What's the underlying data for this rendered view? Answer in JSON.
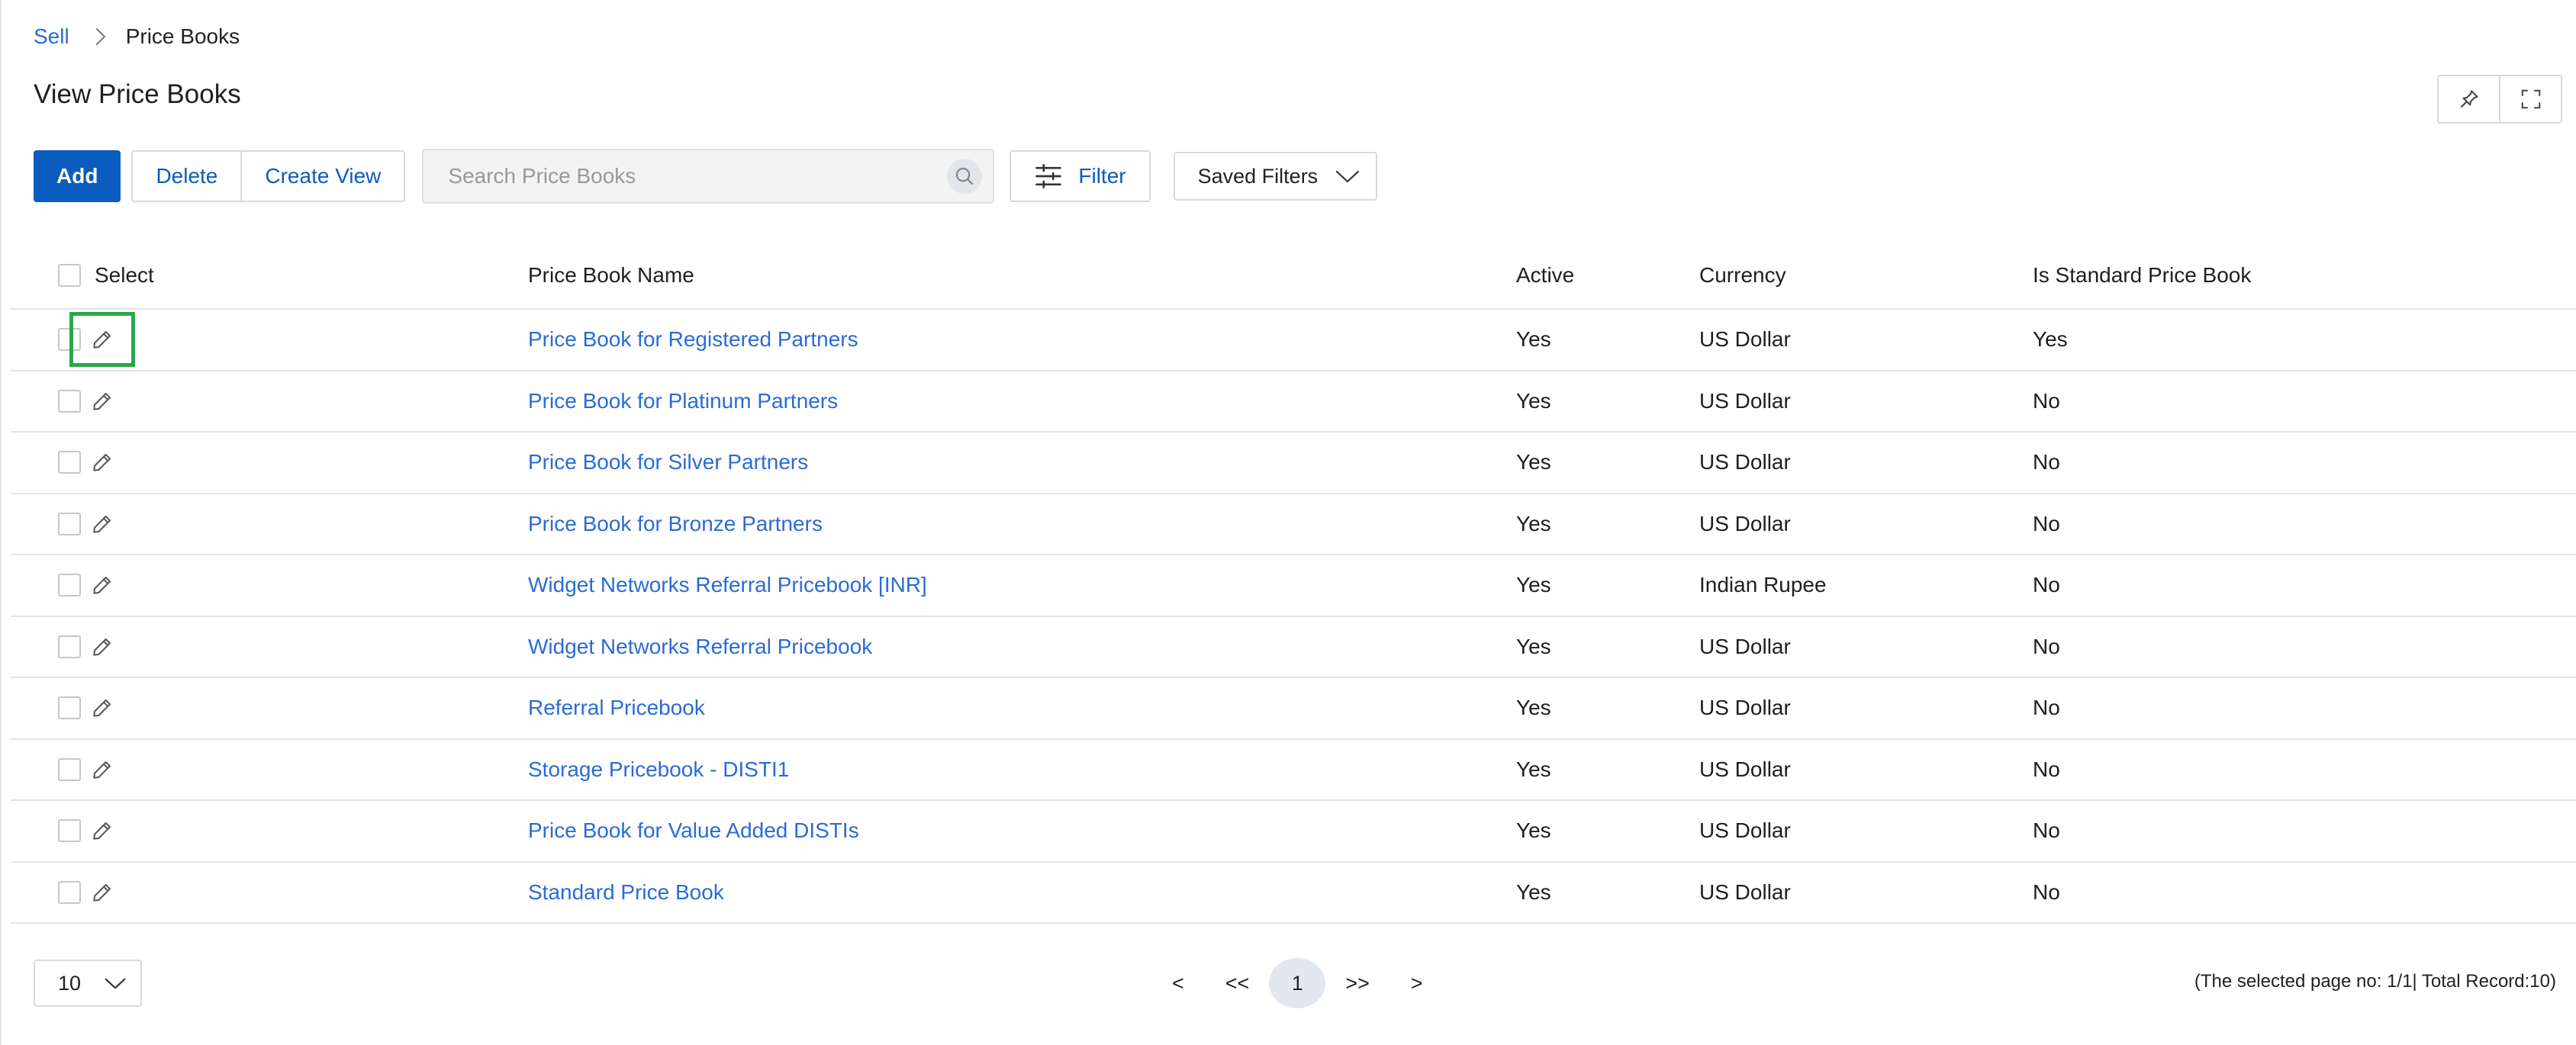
{
  "breadcrumb": {
    "root": "Sell",
    "current": "Price Books"
  },
  "page_title": "View Price Books",
  "toolbar": {
    "add_label": "Add",
    "delete_label": "Delete",
    "create_view_label": "Create View",
    "search_placeholder": "Search Price Books",
    "filter_label": "Filter",
    "saved_filters_label": "Saved Filters"
  },
  "table": {
    "headers": {
      "select": "Select",
      "name": "Price Book Name",
      "active": "Active",
      "currency": "Currency",
      "standard": "Is Standard Price Book"
    },
    "rows": [
      {
        "name": "Price Book for Registered Partners",
        "active": "Yes",
        "currency": "US Dollar",
        "standard": "Yes"
      },
      {
        "name": "Price Book for Platinum Partners",
        "active": "Yes",
        "currency": "US Dollar",
        "standard": "No"
      },
      {
        "name": "Price Book for Silver Partners",
        "active": "Yes",
        "currency": "US Dollar",
        "standard": "No"
      },
      {
        "name": "Price Book for Bronze Partners",
        "active": "Yes",
        "currency": "US Dollar",
        "standard": "No"
      },
      {
        "name": "Widget Networks Referral Pricebook [INR]",
        "active": "Yes",
        "currency": "Indian Rupee",
        "standard": "No"
      },
      {
        "name": "Widget Networks Referral Pricebook",
        "active": "Yes",
        "currency": "US Dollar",
        "standard": "No"
      },
      {
        "name": "Referral Pricebook",
        "active": "Yes",
        "currency": "US Dollar",
        "standard": "No"
      },
      {
        "name": "Storage Pricebook - DISTI1",
        "active": "Yes",
        "currency": "US Dollar",
        "standard": "No"
      },
      {
        "name": "Price Book for Value Added DISTIs",
        "active": "Yes",
        "currency": "US Dollar",
        "standard": "No"
      },
      {
        "name": "Standard Price Book",
        "active": "Yes",
        "currency": "US Dollar",
        "standard": "No"
      }
    ]
  },
  "pagination": {
    "page_size": "10",
    "prev": "<",
    "first": "<<",
    "current": "1",
    "last": ">>",
    "next": ">",
    "record_info": "(The selected page no: 1/1| Total Record:10)"
  },
  "colors": {
    "primary": "#0b5cbf",
    "link": "#2b6bd6",
    "highlight": "#2aa84a"
  },
  "icons": {
    "pin": "pin-icon",
    "fullscreen": "fullscreen-icon",
    "search": "search-icon",
    "filter": "filter-sliders-icon",
    "dropdown": "chevron-down-icon",
    "edit": "pencil-icon"
  }
}
